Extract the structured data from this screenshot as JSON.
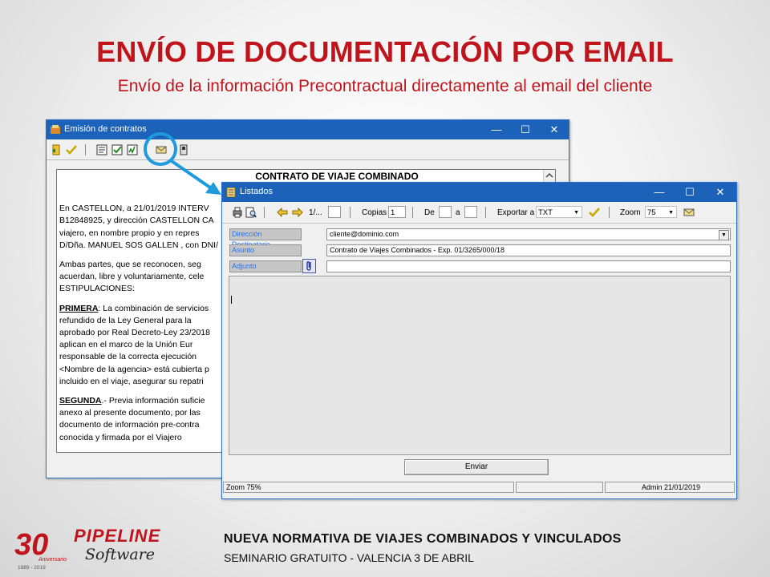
{
  "slide": {
    "title": "ENVÍO DE DOCUMENTACIÓN POR EMAIL",
    "subtitle": "Envío de la información Precontractual directamente al email del cliente"
  },
  "win_contratos": {
    "title": "Emisión de contratos",
    "controls": {
      "minimize": "—",
      "maximize": "☐",
      "close": "✕"
    },
    "doc": {
      "heading": "CONTRATO DE VIAJE COMBINADO",
      "p1": [
        "En CASTELLON, a 21/01/2019 INTERV",
        "B12848925, y dirección CASTELLON CA",
        "viajero, en nombre propio y en repres",
        "D/Dña. MANUEL SOS GALLEN , con DNI/"
      ],
      "p2": [
        "Ambas partes, que se reconocen, seg",
        "acuerdan, libre y voluntariamente, cele",
        "ESTIPULACIONES:"
      ],
      "p3_label": "PRIMERA",
      "p3": [
        ": La combinación de servicios",
        "refundido de la Ley General para la",
        "aprobado por Real Decreto-Ley 23/2018",
        "aplican en el marco de la Unión Eur",
        "responsable de la correcta ejecución",
        "<Nombre de la agencia> está cubierta p",
        "incluido en el viaje, asegurar su repatri"
      ],
      "p4_label": "SEGUNDA",
      "p4": [
        ".- Previa información suficie",
        "anexo al presente documento, por las",
        "documento de información pre-contra",
        "conocida y firmada por el Viajero"
      ]
    }
  },
  "win_listados": {
    "title": "Listados",
    "controls": {
      "minimize": "—",
      "maximize": "☐",
      "close": "✕"
    },
    "toolbar": {
      "page_label": "1/...",
      "copies_label": "Copias",
      "copies_value": "1",
      "from_label": "De",
      "to_label": "a",
      "export_label": "Exportar a",
      "export_value": "TXT",
      "zoom_label": "Zoom",
      "zoom_value": "75"
    },
    "fields": {
      "dest_label": "Dirección Destinatario",
      "dest_value": "cliente@dominio.com",
      "subject_label": "Asunto",
      "subject_value": "Contrato de Viajes Combinados - Exp. 01/3265/000/18",
      "attach_label": "Adjunto",
      "attach_value": ""
    },
    "send_button": "Enviar",
    "status": {
      "zoom": "Zoom 75%",
      "middle": "",
      "user_date": "Admin 21/01/2019"
    }
  },
  "footer": {
    "line1": "NUEVA NORMATIVA DE VIAJES COMBINADOS Y VINCULADOS",
    "line2": "SEMINARIO GRATUITO - VALENCIA 3 DE ABRIL",
    "logo_number": "30",
    "logo_brand": "PIPELINE",
    "logo_sub": "Software",
    "logo_anniv": "Aniversario",
    "logo_years": "1989 - 2019"
  },
  "colors": {
    "accent_red": "#c0141c",
    "titlebar_blue": "#1c62b9",
    "callout_blue": "#1e9bdc"
  }
}
